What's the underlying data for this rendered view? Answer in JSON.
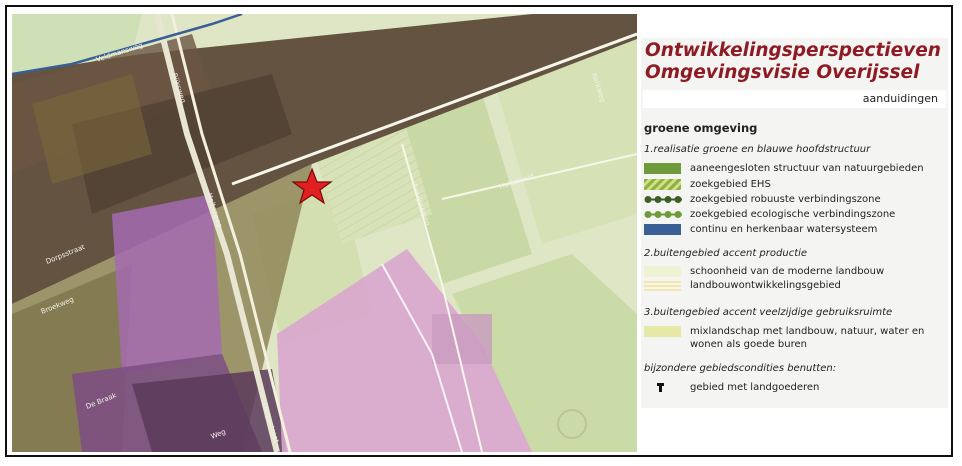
{
  "legend": {
    "title_line1": "Ontwikkelingsperspectieven",
    "title_line2": "Omgevingsvisie Overijssel",
    "tab_label": "aanduidingen",
    "section_title": "groene omgeving",
    "groups": [
      {
        "title": "1.realisatie groene en blauwe hoofdstructuur",
        "items": [
          {
            "label": "aaneengesloten structuur van natuurgebieden",
            "color": "#6f9a3c",
            "icon": "solid-green-swatch"
          },
          {
            "label": "zoekgebied EHS",
            "color": "#8fb33f",
            "icon": "hatched-green-swatch"
          },
          {
            "label": "zoekgebied robuuste verbindingszone",
            "color": "#3f5e25",
            "icon": "dark-dots-swatch"
          },
          {
            "label": "zoekgebied ecologische verbindingszone",
            "color": "#6f9a3c",
            "icon": "green-dots-swatch"
          },
          {
            "label": "continu en herkenbaar watersysteem",
            "color": "#3a5f95",
            "icon": "blue-swatch"
          }
        ]
      },
      {
        "title": "2.buitengebied accent productie",
        "items": [
          {
            "label": "schoonheid van de moderne landbouw",
            "color": "#eef1d2",
            "icon": "pale-swatch"
          },
          {
            "label": "landbouwontwikkelingsgebied",
            "color": "#f0e6b5",
            "icon": "striped-swatch"
          }
        ]
      },
      {
        "title": "3.buitengebied accent veelzijdige gebruiksruimte",
        "items": [
          {
            "label": "mixlandschap met landbouw, natuur, water en wonen als goede buren",
            "color": "#e6e8a6",
            "icon": "yellow-green-swatch"
          }
        ]
      }
    ],
    "special_title": "bijzondere gebiedscondities benutten:",
    "special_item": {
      "label": "gebied met landgoederen",
      "icon": "estate-marker-icon"
    }
  },
  "map": {
    "street_labels": [
      "Veldmansweg",
      "Rijksweg",
      "Holterweg",
      "Dorpsstraat",
      "Broekweg",
      "De Braak",
      "Weg",
      "Holterveld",
      "Averloseweg",
      "Kerkweg",
      "Dorpsstraat"
    ],
    "marker": {
      "icon": "red-star-icon",
      "color": "#e02020"
    },
    "colors": {
      "field_light": "#dfe6c6",
      "field_green": "#c9d9a6",
      "urban_band": "#4a3a2e",
      "pink_zone": "#d9a6cf",
      "purple_zone": "#a56bb0",
      "water": "#3a5f95"
    }
  }
}
